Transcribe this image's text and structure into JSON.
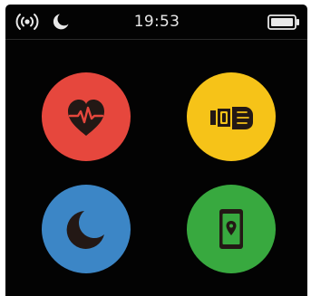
{
  "status_bar": {
    "time": "19:53",
    "icons": [
      "signal-icon",
      "moon-icon",
      "battery-icon"
    ]
  },
  "apps": [
    {
      "icon": "heart-rate-icon",
      "color": "#e6473d"
    },
    {
      "icon": "sport-wrist-icon",
      "color": "#f6c318"
    },
    {
      "icon": "sleep-moon-icon",
      "color": "#3c86c6"
    },
    {
      "icon": "find-phone-icon",
      "color": "#38a93f"
    }
  ],
  "colors": {
    "background": "#030303",
    "status_text": "#e8e8e8",
    "icon_glyph": "#231815"
  }
}
